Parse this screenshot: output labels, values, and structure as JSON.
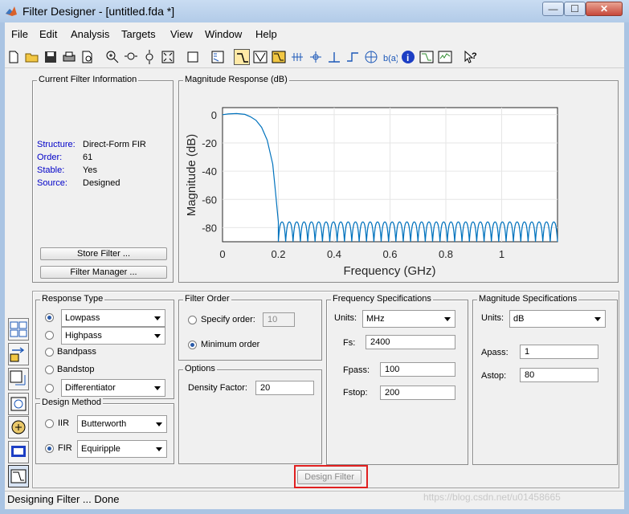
{
  "window": {
    "title": "Filter Designer - [untitled.fda *]",
    "controls": {
      "minimize": "—",
      "maximize": "☐",
      "close": "✕"
    }
  },
  "menu": [
    "File",
    "Edit",
    "Analysis",
    "Targets",
    "View",
    "Window",
    "Help"
  ],
  "toolbar": {
    "icons": [
      "new-icon",
      "open-icon",
      "save-icon",
      "print-icon",
      "print-preview-icon",
      "zoom-in-icon",
      "zoom-x-icon",
      "zoom-y-icon",
      "full-view-icon",
      "new-figure-icon",
      "full-view-analysis-icon",
      "magnitude-response-icon",
      "phase-response-icon",
      "magnitude-phase-icon",
      "group-delay-icon",
      "phase-delay-icon",
      "impulse-response-icon",
      "step-response-icon",
      "pole-zero-icon",
      "filter-coefficients-icon",
      "filter-info-icon",
      "magnitude-estimate-icon",
      "round-off-noise-icon",
      "whats-this-icon"
    ],
    "active": "magnitude-response-icon"
  },
  "current_filter_info": {
    "title": "Current Filter Information",
    "rows": [
      {
        "label": "Structure:",
        "value": "Direct-Form FIR"
      },
      {
        "label": "Order:",
        "value": "61"
      },
      {
        "label": "Stable:",
        "value": "Yes"
      },
      {
        "label": "Source:",
        "value": "Designed"
      }
    ],
    "store_button": "Store Filter ...",
    "manager_button": "Filter Manager ..."
  },
  "plot_panel_title": "Magnitude Response (dB)",
  "chart_data": {
    "type": "line",
    "title": "",
    "xlabel": "Frequency (GHz)",
    "ylabel": "Magnitude (dB)",
    "xlim": [
      0,
      1.2
    ],
    "ylim": [
      -90,
      5
    ],
    "xticks": [
      "0",
      "0.2",
      "0.4",
      "0.6",
      "0.8",
      "1"
    ],
    "yticks": [
      "0",
      "-20",
      "-40",
      "-60",
      "-80"
    ],
    "grid": true,
    "series": [
      {
        "color": "#0072bd",
        "passband": {
          "x": [
            0,
            0.02,
            0.05,
            0.08,
            0.1,
            0.12,
            0.14,
            0.16,
            0.18,
            0.19,
            0.2
          ],
          "y": [
            0,
            0.5,
            0.8,
            0.2,
            -1.5,
            -4,
            -9,
            -18,
            -35,
            -55,
            -76
          ]
        },
        "stopband_ripple": {
          "from": 0.2,
          "to": 1.2,
          "lobes": 38,
          "peak_db": -76,
          "null_db": -90
        }
      }
    ]
  },
  "response_type": {
    "title": "Response Type",
    "options": [
      {
        "label": "Lowpass",
        "selected": true,
        "has_combo": true
      },
      {
        "label": "Highpass",
        "selected": false,
        "has_combo": true
      },
      {
        "label": "Bandpass",
        "selected": false,
        "has_combo": false
      },
      {
        "label": "Bandstop",
        "selected": false,
        "has_combo": false
      },
      {
        "label": "Differentiator",
        "selected": false,
        "has_combo": true
      }
    ]
  },
  "design_method": {
    "title": "Design Method",
    "iir_label": "IIR",
    "iir_value": "Butterworth",
    "fir_label": "FIR",
    "fir_value": "Equiripple",
    "selected": "FIR"
  },
  "filter_order": {
    "title": "Filter Order",
    "specify_label": "Specify order:",
    "specify_value": "10",
    "minimum_label": "Minimum order",
    "selected": "Minimum order"
  },
  "options": {
    "title": "Options",
    "density_label": "Density Factor:",
    "density_value": "20"
  },
  "freq_specs": {
    "title": "Frequency Specifications",
    "units_label": "Units:",
    "units_value": "MHz",
    "fs_label": "Fs:",
    "fs_value": "2400",
    "fpass_label": "Fpass:",
    "fpass_value": "100",
    "fstop_label": "Fstop:",
    "fstop_value": "200"
  },
  "mag_specs": {
    "title": "Magnitude Specifications",
    "units_label": "Units:",
    "units_value": "dB",
    "apass_label": "Apass:",
    "apass_value": "1",
    "astop_label": "Astop:",
    "astop_value": "80"
  },
  "design_button": "Design Filter",
  "highlight_color": "#e02020",
  "status": "Designing Filter ... Done",
  "watermark": "https://blog.csdn.net/u01458665"
}
